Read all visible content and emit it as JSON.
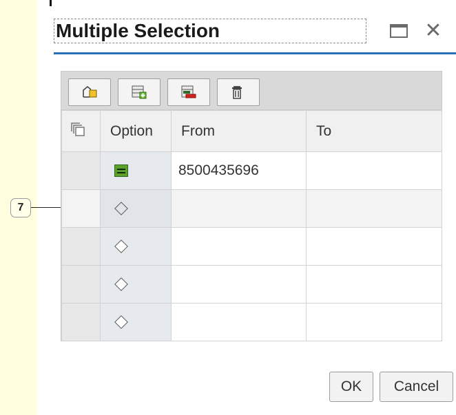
{
  "annotation": {
    "callout_number": "7"
  },
  "dialog": {
    "title": "Multiple Selection",
    "maximize_icon": "maximize-icon",
    "close_icon": "close-icon",
    "close_glyph": "✕"
  },
  "toolbar": {
    "buttons": [
      {
        "name": "select-all-icon"
      },
      {
        "name": "insert-row-icon"
      },
      {
        "name": "delete-row-icon"
      },
      {
        "name": "trash-icon"
      }
    ]
  },
  "grid": {
    "columns": {
      "selector_icon": "select-all-rows-icon",
      "option": "Option",
      "from": "From",
      "to": "To"
    },
    "rows": [
      {
        "option": "equals-icon",
        "from": "8500435696",
        "to": ""
      },
      {
        "option": "diamond-icon",
        "from": "",
        "to": ""
      },
      {
        "option": "diamond-icon",
        "from": "",
        "to": ""
      },
      {
        "option": "diamond-icon",
        "from": "",
        "to": ""
      },
      {
        "option": "diamond-icon",
        "from": "",
        "to": ""
      }
    ]
  },
  "footer": {
    "ok_label": "OK",
    "cancel_label": "Cancel"
  },
  "colors": {
    "accent_rule": "#2a6fb5",
    "equals_green": "#5aa02c",
    "side_strip": "#ffffe0"
  }
}
